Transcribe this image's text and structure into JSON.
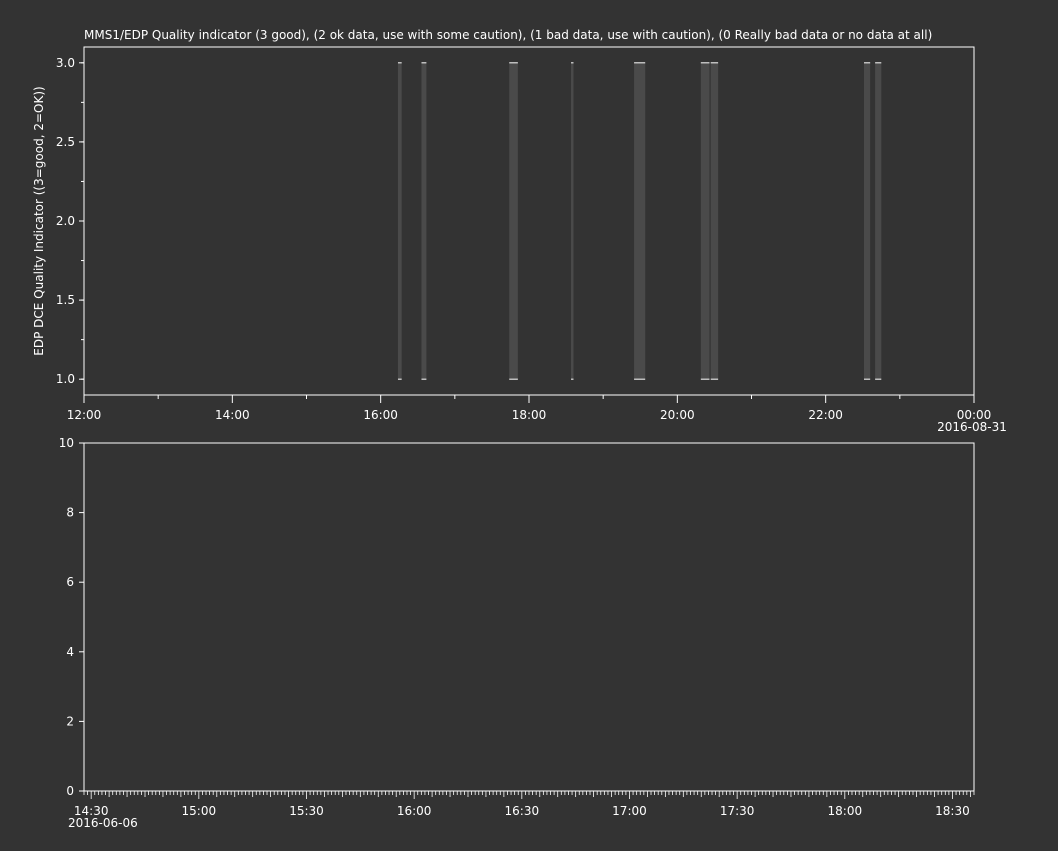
{
  "chart_data": [
    {
      "type": "line",
      "title": "MMS1/EDP  Quality indicator (3 good), (2 ok data, use with some caution), (1 bad data, use with caution), (0 Really bad data or no data at all)",
      "xlabel": "",
      "ylabel": "EDP DCE Quality Indicator ((3=good, 2=OK))",
      "x_range": [
        "2016-08-30 12:00",
        "2016-08-31 00:00"
      ],
      "ylim": [
        0.9,
        3.1
      ],
      "y_ticks": [
        1.0,
        1.5,
        2.0,
        2.5,
        3.0
      ],
      "y_tick_labels": [
        "1.0",
        "1.5",
        "2.0",
        "2.5",
        "3.0"
      ],
      "x_ticks": [
        "12:00",
        "14:00",
        "16:00",
        "18:00",
        "20:00",
        "22:00",
        "00:00"
      ],
      "x_tick_labels": [
        "12:00",
        "14:00",
        "16:00",
        "18:00",
        "20:00",
        "22:00",
        "00:00"
      ],
      "date_label": "2016-08-31",
      "segments": [
        {
          "start": "16:14",
          "end": "16:17"
        },
        {
          "start": "16:33",
          "end": "16:37"
        },
        {
          "start": "17:44",
          "end": "17:51"
        },
        {
          "start": "18:34",
          "end": "18:36"
        },
        {
          "start": "19:25",
          "end": "19:34"
        },
        {
          "start": "20:19",
          "end": "20:26"
        },
        {
          "start": "20:27",
          "end": "20:33"
        },
        {
          "start": "22:31",
          "end": "22:36"
        },
        {
          "start": "22:40",
          "end": "22:45"
        }
      ],
      "segment_values": [
        1,
        3
      ],
      "grid": false
    },
    {
      "type": "line",
      "title": "",
      "xlabel": "",
      "ylabel": "",
      "x_range": [
        "2016-06-06 14:28",
        "2016-06-06 18:36"
      ],
      "ylim": [
        0,
        10
      ],
      "y_ticks": [
        0,
        2,
        4,
        6,
        8,
        10
      ],
      "y_tick_labels": [
        "0",
        "2",
        "4",
        "6",
        "8",
        "10"
      ],
      "x_ticks": [
        "14:30",
        "15:00",
        "15:30",
        "16:00",
        "16:30",
        "17:00",
        "17:30",
        "18:00",
        "18:30"
      ],
      "x_tick_labels": [
        "14:30",
        "15:00",
        "15:30",
        "16:00",
        "16:30",
        "17:00",
        "17:30",
        "18:00",
        "18:30"
      ],
      "date_label": "2016-06-06",
      "series": [],
      "grid": false
    }
  ]
}
